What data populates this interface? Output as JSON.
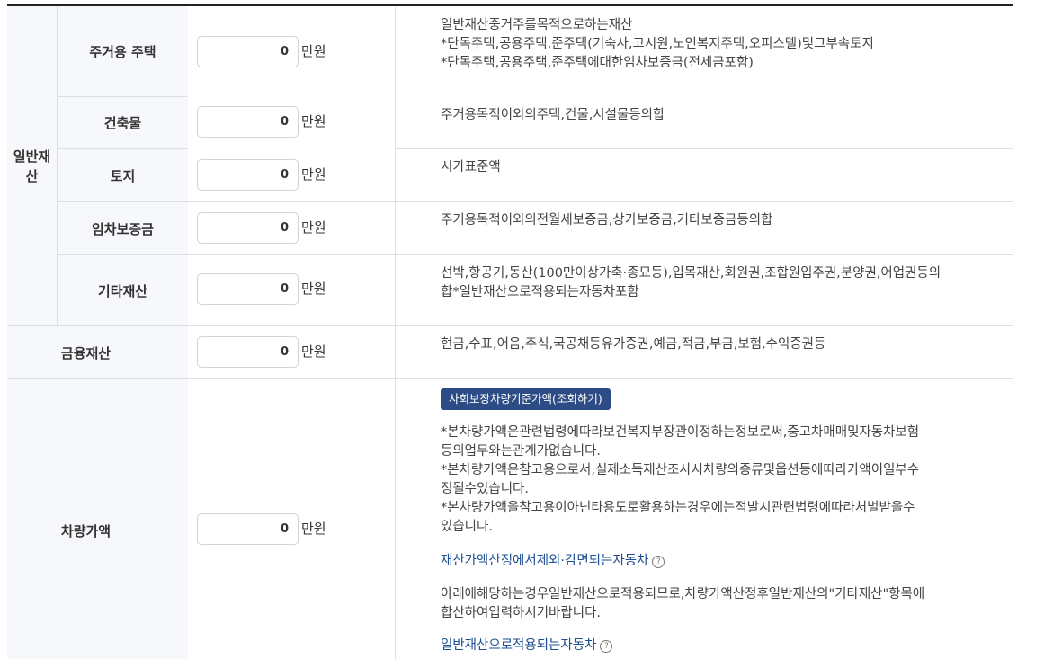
{
  "general_group": {
    "label_line1": "일반재",
    "label_line2": "산"
  },
  "unit": "만원",
  "rows": [
    {
      "label": "주거용 주택",
      "value": "0",
      "desc": [
        "일반재산중거주를목적으로하는재산",
        "*단독주택,공용주택,준주택(기숙사,고시원,노인복지주택,오피스텔)및그부속토지",
        "*단독주택,공용주택,준주택에대한임차보증금(전세금포함)"
      ]
    },
    {
      "label": "건축물",
      "value": "0",
      "desc": [
        "주거용목적이외의주택,건물,시설물등의합"
      ]
    },
    {
      "label": "토지",
      "value": "0",
      "desc": [
        "시가표준액"
      ]
    },
    {
      "label": "임차보증금",
      "value": "0",
      "desc": [
        "주거용목적이외의전월세보증금,상가보증금,기타보증금등의합"
      ]
    },
    {
      "label": "기타재산",
      "value": "0",
      "desc": [
        "선박,항공기,동산(100만이상가축·종묘등),입목재산,회원권,조합원입주권,분양권,어업권등의",
        "합*일반재산으로적용되는자동차포함"
      ]
    },
    {
      "label": "금융재산",
      "value": "0",
      "desc": [
        "현금,수표,어음,주식,국공채등유가증권,예금,적금,부금,보험,수익증권등"
      ]
    }
  ],
  "vehicle": {
    "label": "차량가액",
    "value": "0",
    "button_label": "사회보장차량기준가액(조회하기)",
    "notes": [
      "*본차량가액은관련법령에따라보건복지부장관이정하는정보로써,중고차매매및자동차보험",
      "등의업무와는관계가없습니다.",
      "*본차량가액은참고용으로서,실제소득재산조사시차량의종류및옵션등에따라가액이일부수",
      "정될수있습니다.",
      "*본차량가액을참고용이아닌타용도로활용하는경우에는적발시관련법령에따라처벌받을수",
      "있습니다."
    ],
    "link1": "재산가액산정에서제외·감면되는자동차",
    "para": [
      "아래에해당하는경우일반재산으로적용되므로,차량가액산정후일반재산의\"기타재산\"항목에",
      "합산하여입력하시기바랍니다."
    ],
    "link2": "일반재산으로적용되는자동차",
    "help_icon": "?"
  }
}
